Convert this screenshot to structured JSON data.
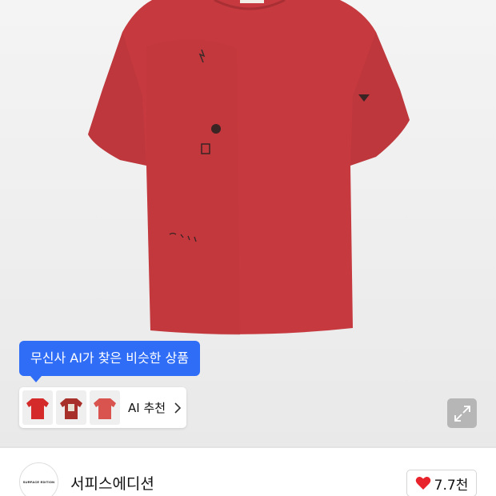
{
  "hero": {
    "ai_tooltip": "무신사 AI가 찾은 비슷한 상품",
    "ai_card_label": "AI 추천",
    "thumbnails": [
      {
        "icon": "red-tshirt-thumbnail",
        "color": "#d42a2a"
      },
      {
        "icon": "red-graphic-tshirt-thumbnail",
        "color": "#a8302a"
      },
      {
        "icon": "red-tshirt-thumbnail",
        "color": "#d9534f"
      }
    ],
    "expand_icon": "expand-icon",
    "product_color": "#c63a3f"
  },
  "brand": {
    "logo_text": "SURFACE EDITION",
    "name": "서피스에디션"
  },
  "like": {
    "icon": "heart-icon",
    "count": "7.7천",
    "heart_color": "#e8232b"
  },
  "colors": {
    "accent": "#2f6df6"
  }
}
